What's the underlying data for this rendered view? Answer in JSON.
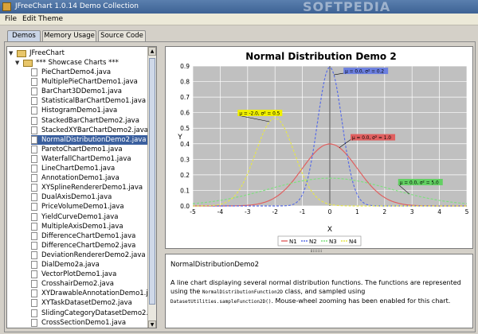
{
  "window": {
    "title": "JFreeChart 1.0.14 Demo Collection",
    "watermark": "SOFTPEDIA"
  },
  "menu": {
    "items": [
      "File",
      "Edit",
      "Theme"
    ]
  },
  "tabs": [
    {
      "label": "Demos",
      "active": true
    },
    {
      "label": "Memory Usage",
      "active": false
    },
    {
      "label": "Source Code",
      "active": false
    }
  ],
  "tree": {
    "root": "JFreeChart",
    "folder": "*** Showcase Charts ***",
    "selected": "NormalDistributionDemo2.java",
    "items": [
      "PieChartDemo4.java",
      "MultiplePieChartDemo1.java",
      "BarChart3DDemo1.java",
      "StatisticalBarChartDemo1.java",
      "HistogramDemo1.java",
      "StackedBarChartDemo2.java",
      "StackedXYBarChartDemo2.java",
      "NormalDistributionDemo2.java",
      "ParetoChartDemo1.java",
      "WaterfallChartDemo1.java",
      "LineChartDemo1.java",
      "AnnotationDemo1.java",
      "XYSplineRendererDemo1.java",
      "DualAxisDemo1.java",
      "PriceVolumeDemo1.java",
      "YieldCurveDemo1.java",
      "MultipleAxisDemo1.java",
      "DifferenceChartDemo1.java",
      "DifferenceChartDemo2.java",
      "DeviationRendererDemo2.java",
      "DialDemo2a.java",
      "VectorPlotDemo1.java",
      "CrosshairDemo2.java",
      "XYDrawableAnnotationDemo1.java",
      "XYTaskDatasetDemo2.java",
      "SlidingCategoryDatasetDemo2.java",
      "CrossSectionDemo1.java"
    ]
  },
  "chart_data": {
    "type": "line",
    "title": "Normal Distribution Demo 2",
    "xlabel": "X",
    "ylabel": "Y",
    "xlim": [
      -5,
      5
    ],
    "ylim": [
      0,
      0.9
    ],
    "xticks": [
      -5,
      -4,
      -3,
      -2,
      -1,
      0,
      1,
      2,
      3,
      4,
      5
    ],
    "yticks": [
      0.0,
      0.1,
      0.2,
      0.3,
      0.4,
      0.5,
      0.6,
      0.7,
      0.8,
      0.9
    ],
    "grid": true,
    "legend_position": "bottom",
    "series": [
      {
        "name": "N1",
        "mean": 0.0,
        "variance": 1.0,
        "color": "#e06060",
        "annotation": "μ = 0.0, σ² = 1.0",
        "label_bg": "#e06060"
      },
      {
        "name": "N2",
        "mean": 0.0,
        "variance": 0.2,
        "color": "#5a6ee6",
        "annotation": "μ = 0.0, σ² = 0.2",
        "label_bg": "#6b7fe0"
      },
      {
        "name": "N3",
        "mean": 0.0,
        "variance": 5.0,
        "color": "#7ee07e",
        "annotation": "μ = 0.0, σ² = 5.0",
        "label_bg": "#62d062"
      },
      {
        "name": "N4",
        "mean": -2.0,
        "variance": 0.5,
        "color": "#e6e64a",
        "annotation": "μ = -2.0, σ² = 0.5",
        "label_bg": "#f0f000"
      }
    ]
  },
  "description": {
    "title": "NormalDistributionDemo2",
    "text_1": "A line chart displaying several normal distribution functions. The functions are represented using the",
    "code_1": "NormalDistributionFunction2D",
    "text_2": " class, and sampled using ",
    "code_2": "DatasetUtilities.sampleFunction2D()",
    "text_3": ". Mouse-wheel zooming has been enabled for this chart."
  }
}
